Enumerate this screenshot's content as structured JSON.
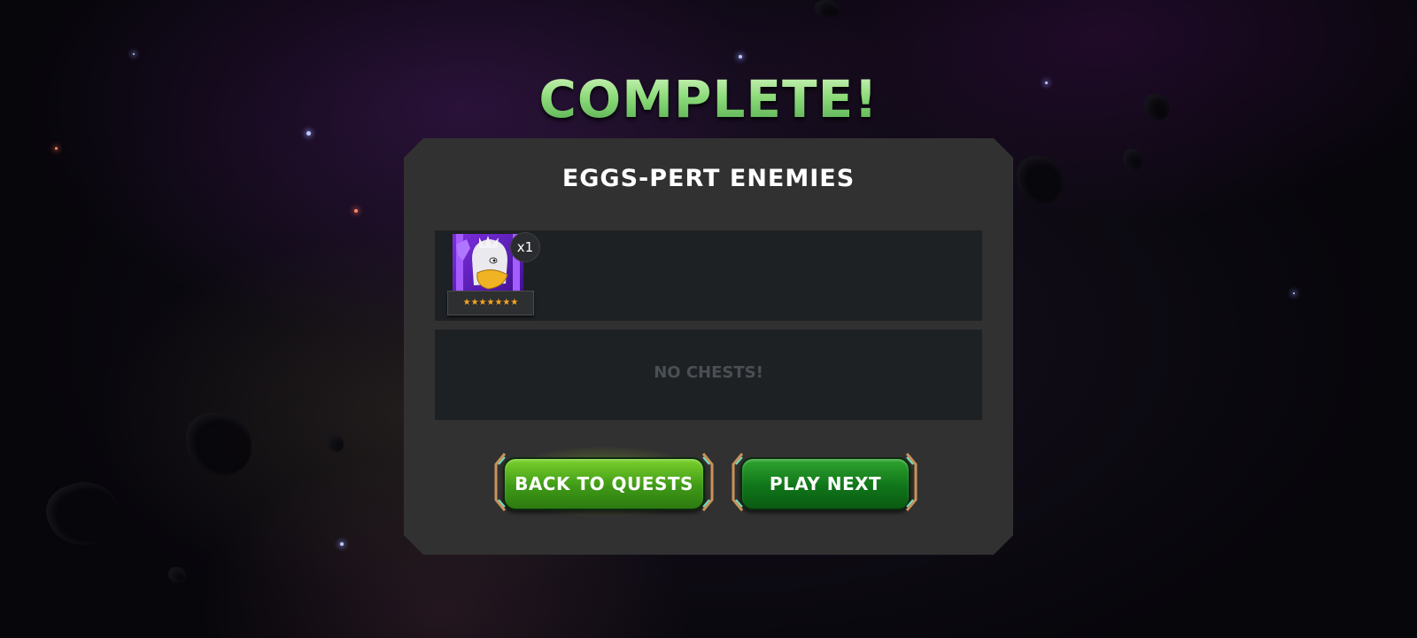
{
  "screen": {
    "title": "COMPLETE!",
    "quest_name": "EGGS-PERT ENEMIES"
  },
  "rewards": {
    "champion": {
      "icon": "champion-portrait-icon",
      "count": "x1",
      "star_rating_text": "★★★★★★★",
      "stars": 7,
      "class_color": "#7d2ee0"
    },
    "chests_text": "NO CHESTS!"
  },
  "buttons": {
    "back_label": "BACK TO QUESTS",
    "next_label": "PLAY NEXT"
  },
  "colors": {
    "title_green": "#8fdc7c",
    "panel_bg": "#323131",
    "box_bg": "#1e2124",
    "star_orange": "#f5a623"
  }
}
